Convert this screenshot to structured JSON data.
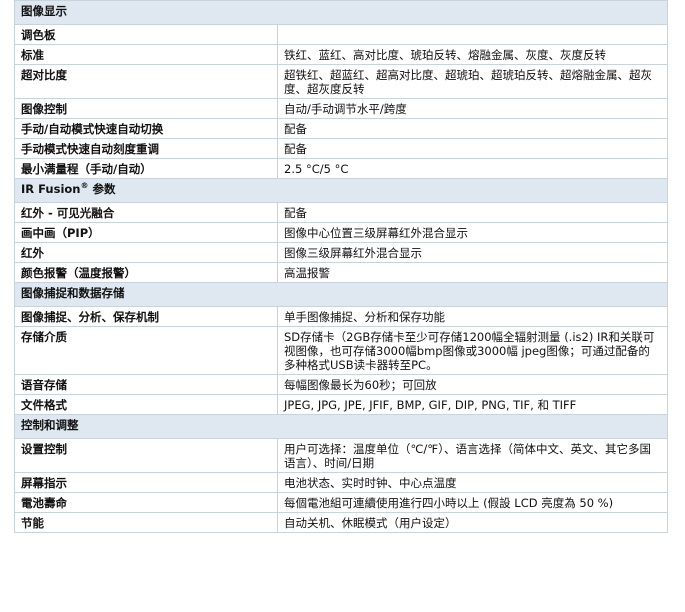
{
  "sections": [
    {
      "title": "图像显示",
      "rows": [
        {
          "label": "调色板",
          "value": ""
        },
        {
          "label": "标准",
          "value": "铁红、蓝红、高对比度、琥珀反转、熔融金属、灰度、灰度反转"
        },
        {
          "label": "超对比度",
          "value": "超铁红、超蓝红、超高对比度、超琥珀、超琥珀反转、超熔融金属、超灰度、超灰度反转"
        },
        {
          "label": "图像控制",
          "value": "自动/手动调节水平/跨度"
        },
        {
          "label": "手动/自动模式快速自动切换",
          "value": "配备"
        },
        {
          "label": "手动模式快速自动刻度重调",
          "value": "配备"
        },
        {
          "label": "最小满量程（手动/自动）",
          "value": "2.5 °C/5 °C"
        }
      ]
    },
    {
      "title": "IR Fusion",
      "title_sup": "®",
      "title_suffix": " 参数",
      "rows": [
        {
          "label": "红外 - 可见光融合",
          "value": "配备"
        },
        {
          "label": "画中画（PIP）",
          "value": "图像中心位置三级屏幕红外混合显示"
        },
        {
          "label": "红外",
          "value": "图像三级屏幕红外混合显示"
        },
        {
          "label": "颜色报警（温度报警）",
          "value": "高温报警"
        }
      ]
    },
    {
      "title": "图像捕捉和数据存储",
      "rows": [
        {
          "label": "图像捕捉、分析、保存机制",
          "value": "单手图像捕捉、分析和保存功能"
        },
        {
          "label": "存储介质",
          "value": "SD存储卡（2GB存储卡至少可存储1200幅全辐射测量 (.is2) IR和关联可视图像，也可存储3000幅bmp图像或3000幅 jpeg图像；可通过配备的多种格式USB读卡器转至PC。"
        },
        {
          "label": "语音存储",
          "value": "每幅图像最长为60秒；可回放"
        },
        {
          "label": "文件格式",
          "value": "JPEG, JPG, JPE, JFIF, BMP, GIF, DIP, PNG, TIF, 和 TIFF"
        }
      ]
    },
    {
      "title": "控制和调整",
      "rows": [
        {
          "label": "设置控制",
          "value": "用户可选择：温度单位（℃/℉）、语言选择（简体中文、英文、其它多国语言）、时间/日期"
        },
        {
          "label": "屏幕指示",
          "value": "电池状态、实时时钟、中心点温度"
        },
        {
          "label": "電池壽命",
          "value": "每個電池組可連續使用進行四小時以上 (假設 LCD 亮度為 50 %)"
        },
        {
          "label": "节能",
          "value": "自动关机、休眠模式（用户设定）"
        }
      ]
    }
  ]
}
